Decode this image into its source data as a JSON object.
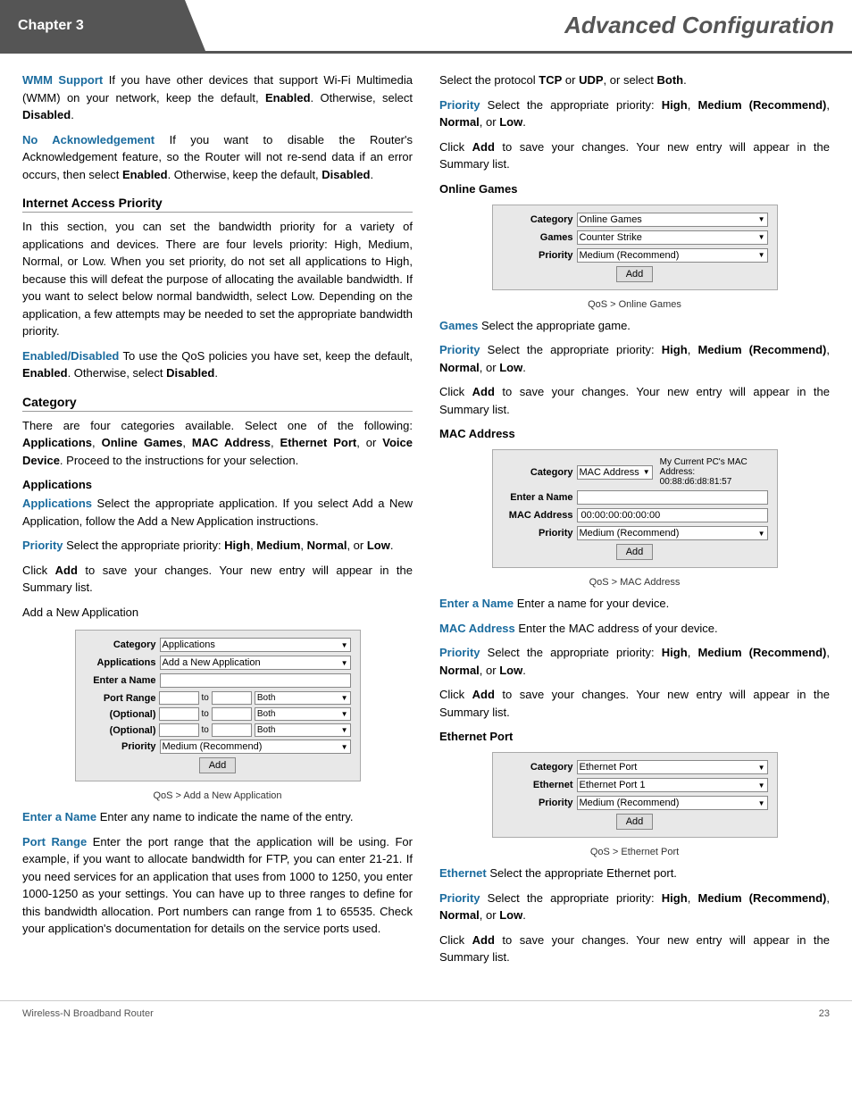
{
  "header": {
    "chapter": "Chapter 3",
    "title": "Advanced Configuration"
  },
  "footer": {
    "left": "Wireless-N Broadband Router",
    "right": "23"
  },
  "left_col": {
    "para1_term": "WMM Support",
    "para1_text": "  If you have other devices that support Wi-Fi Multimedia (WMM) on your network, keep the default, ",
    "para1_bold1": "Enabled",
    "para1_text2": ". Otherwise, select ",
    "para1_bold2": "Disabled",
    "para1_text3": ".",
    "para2_term": "No Acknowledgement",
    "para2_text": "  If you want to disable the Router's Acknowledgement feature, so the Router will not re-send data if an error occurs, then select ",
    "para2_bold1": "Enabled",
    "para2_text2": ". Otherwise, keep the default, ",
    "para2_bold2": "Disabled",
    "para2_text3": ".",
    "section1": "Internet Access Priority",
    "section1_body": "In this section, you can set the bandwidth priority for a variety of applications and devices. There are four levels priority: High, Medium, Normal, or Low. When you set priority, do not set all applications to High, because this will defeat the purpose of allocating the available bandwidth. If you want to select below normal bandwidth, select Low. Depending on the application, a few attempts may be needed to set the appropriate bandwidth priority.",
    "para3_term": "Enabled/Disabled",
    "para3_text": "  To use the QoS policies you have set, keep the default, ",
    "para3_bold1": "Enabled",
    "para3_text2": ". Otherwise, select ",
    "para3_bold2": "Disabled",
    "para3_text3": ".",
    "section2": "Category",
    "section2_body1": "There are four categories available. Select one of the following: ",
    "section2_bold1": "Applications",
    "section2_text1": ", ",
    "section2_bold2": "Online Games",
    "section2_text2": ", ",
    "section2_bold3": "MAC Address",
    "section2_text3": ", ",
    "section2_bold4": "Ethernet Port",
    "section2_text4": ", or ",
    "section2_bold5": "Voice Device",
    "section2_text5": ". Proceed to the instructions for your selection.",
    "sub1": "Applications",
    "app_term": "Applications",
    "app_text": "  Select the appropriate application. If you select Add a New Application, follow the Add a New Application instructions.",
    "priority_term1": "Priority",
    "priority_text1": "  Select the appropriate priority: ",
    "priority_bold1a": "High",
    "priority_text1b": ", ",
    "priority_bold1b": "Medium",
    "priority_text1c": ", ",
    "priority_bold1c": "Normal",
    "priority_text1d": ", or ",
    "priority_bold1d": "Low",
    "priority_text1e": ".",
    "click_add1": "Click ",
    "click_add1_bold": "Add",
    "click_add1_text": " to save your changes. Your new entry will appear in the Summary list.",
    "add_new_app": "Add a New Application",
    "screenshot1": {
      "category_label": "Category",
      "category_value": "Applications",
      "applications_label": "Applications",
      "applications_value": "Add a New Application",
      "enter_name_label": "Enter a Name",
      "port_range_label": "Port Range",
      "port_optional1": "(Optional)",
      "port_optional2": "(Optional)",
      "priority_label": "Priority",
      "priority_value": "Medium (Recommend)",
      "add_btn": "Add",
      "caption": "QoS > Add a New Application"
    },
    "enter_name_term": "Enter a Name",
    "enter_name_text": "  Enter any name to indicate the name of the entry.",
    "port_range_term": "Port Range",
    "port_range_text": "  Enter the port range that the application will be using. For example, if you want to allocate bandwidth for FTP, you can enter 21-21. If you need services for an application that uses from 1000 to 1250, you enter 1000-1250 as your settings. You can have up to three ranges to define for this bandwidth allocation. Port numbers can range from 1 to 65535. Check your application's documentation for details on the service ports used."
  },
  "right_col": {
    "select_protocol": "Select the protocol ",
    "tcp": "TCP",
    "or1": " or ",
    "udp": "UDP",
    "or2": ", or select ",
    "both": "Both",
    "period": ".",
    "priority_term2": "Priority",
    "priority_text2": "  Select the appropriate priority: ",
    "priority_bold2a": "High",
    "priority_text2b": ", ",
    "priority_bold2b": "Medium (Recommend)",
    "priority_text2c": ", ",
    "priority_bold2c": "Normal",
    "priority_text2d": ", or ",
    "priority_bold2d": "Low",
    "priority_text2e": ".",
    "click_add2": "Click ",
    "click_add2_bold": "Add",
    "click_add2_text": " to save your changes. Your new entry will appear in the Summary list.",
    "sub2": "Online Games",
    "screenshot2": {
      "category_label": "Category",
      "category_value": "Online Games",
      "games_label": "Games",
      "games_value": "Counter Strike",
      "priority_label": "Priority",
      "priority_value": "Medium (Recommend)",
      "add_btn": "Add",
      "caption": "QoS > Online Games"
    },
    "games_term": "Games",
    "games_text": "  Select the appropriate game.",
    "priority_term3": "Priority",
    "priority_text3": "  Select the appropriate priority: ",
    "priority_bold3a": "High",
    "priority_text3b": ", ",
    "priority_bold3b": "Medium (Recommend)",
    "priority_text3c": ", ",
    "priority_bold3c": "Normal",
    "priority_text3d": ", or ",
    "priority_bold3d": "Low",
    "priority_text3e": ".",
    "click_add3": "Click ",
    "click_add3_bold": "Add",
    "click_add3_text": " to save your changes. Your new entry will appear in the Summary list.",
    "sub3": "MAC Address",
    "screenshot3": {
      "category_label": "Category",
      "category_value": "MAC Address",
      "mac_note": "My Current PC's MAC Address: 00:88:d6:d8:81:57",
      "enter_name_label": "Enter a Name",
      "mac_address_label": "MAC Address",
      "mac_value": "00:00:00:00:00:00",
      "priority_label": "Priority",
      "priority_value": "Medium (Recommend)",
      "add_btn": "Add",
      "caption": "QoS > MAC Address"
    },
    "enter_name_term2": "Enter a Name",
    "enter_name_text2": "  Enter a name for your device.",
    "mac_address_term": "MAC Address",
    "mac_address_text": "  Enter the MAC address of your device.",
    "priority_term4": "Priority",
    "priority_text4": "  Select the appropriate priority: ",
    "priority_bold4a": "High",
    "priority_text4b": ", ",
    "priority_bold4b": "Medium (Recommend)",
    "priority_text4c": ", ",
    "priority_bold4c": "Normal",
    "priority_text4d": ", or ",
    "priority_bold4d": "Low",
    "priority_text4e": ".",
    "click_add4": "Click ",
    "click_add4_bold": "Add",
    "click_add4_text": " to save your changes. Your new entry will appear in the Summary list.",
    "sub4": "Ethernet Port",
    "screenshot4": {
      "category_label": "Category",
      "category_value": "Ethernet Port",
      "ethernet_label": "Ethernet",
      "ethernet_value": "Ethernet Port 1",
      "priority_label": "Priority",
      "priority_value": "Medium (Recommend)",
      "add_btn": "Add",
      "caption": "QoS > Ethernet Port"
    },
    "ethernet_term": "Ethernet",
    "ethernet_text": "  Select the appropriate Ethernet port.",
    "priority_term5": "Priority",
    "priority_text5": "  Select the appropriate priority: ",
    "priority_bold5a": "High",
    "priority_text5b": ", ",
    "priority_bold5b": "Medium (Recommend)",
    "priority_text5c": ", ",
    "priority_bold5c": "Normal",
    "priority_text5d": ", or ",
    "priority_bold5d": "Low",
    "priority_text5e": ".",
    "click_add5": "Click ",
    "click_add5_bold": "Add",
    "click_add5_text": " to save your changes. Your new entry will appear in the Summary list."
  }
}
